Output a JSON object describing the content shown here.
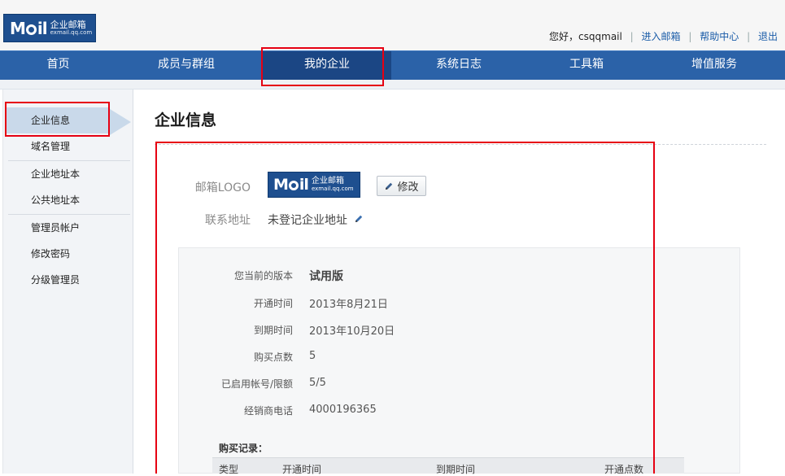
{
  "header": {
    "logo": {
      "brand_left": "M",
      "brand_right": "il",
      "sub_cn": "企业邮箱",
      "sub_en": "exmail.qq.com"
    },
    "greeting": "您好，",
    "username": "csqqmail",
    "links": [
      "进入邮箱",
      "帮助中心",
      "退出"
    ]
  },
  "nav": {
    "items": [
      "首页",
      "成员与群组",
      "我的企业",
      "系统日志",
      "工具箱",
      "增值服务"
    ],
    "active_index": 2
  },
  "sidebar": {
    "items": [
      "企业信息",
      "域名管理",
      "企业地址本",
      "公共地址本",
      "管理员帐户",
      "修改密码",
      "分级管理员"
    ],
    "active_index": 0
  },
  "main": {
    "title": "企业信息",
    "logo_label": "邮箱LOGO",
    "edit_label": "修改",
    "address_label": "联系地址",
    "address_value": "未登记企业地址",
    "details": [
      {
        "label": "您当前的版本",
        "value": "试用版"
      },
      {
        "label": "开通时间",
        "value": "2013年8月21日"
      },
      {
        "label": "到期时间",
        "value": "2013年10月20日"
      },
      {
        "label": "购买点数",
        "value": "5"
      },
      {
        "label": "已启用帐号/限额",
        "value": "5/5"
      },
      {
        "label": "经销商电话",
        "value": "4000196365"
      }
    ],
    "purchase_title": "购买记录：",
    "purchase_columns": [
      "类型",
      "开通时间",
      "到期时间",
      "开通点数"
    ]
  },
  "colors": {
    "nav_bg": "#2b62a8",
    "nav_active": "#1b4684",
    "highlight": "#e60012",
    "link": "#1a5ca8"
  }
}
